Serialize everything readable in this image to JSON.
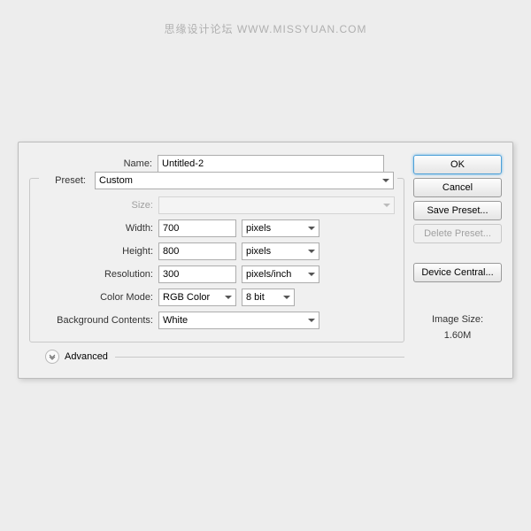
{
  "watermark": "思缘设计论坛  WWW.MISSYUAN.COM",
  "labels": {
    "name": "Name:",
    "preset": "Preset:",
    "size": "Size:",
    "width": "Width:",
    "height": "Height:",
    "resolution": "Resolution:",
    "colorMode": "Color Mode:",
    "bgContents": "Background Contents:",
    "advanced": "Advanced",
    "imageSizeTitle": "Image Size:"
  },
  "values": {
    "name": "Untitled-2",
    "preset": "Custom",
    "size": "",
    "width": "700",
    "height": "800",
    "resolution": "300",
    "widthUnit": "pixels",
    "heightUnit": "pixels",
    "resolutionUnit": "pixels/inch",
    "colorMode": "RGB Color",
    "bitDepth": "8 bit",
    "bgContents": "White",
    "imageSize": "1.60M"
  },
  "buttons": {
    "ok": "OK",
    "cancel": "Cancel",
    "savePreset": "Save Preset...",
    "deletePreset": "Delete Preset...",
    "deviceCentral": "Device Central..."
  }
}
